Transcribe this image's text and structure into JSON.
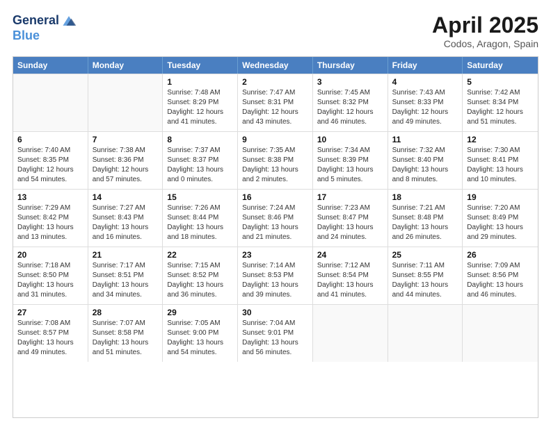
{
  "logo": {
    "line1": "General",
    "line2": "Blue"
  },
  "title": "April 2025",
  "subtitle": "Codos, Aragon, Spain",
  "days_of_week": [
    "Sunday",
    "Monday",
    "Tuesday",
    "Wednesday",
    "Thursday",
    "Friday",
    "Saturday"
  ],
  "weeks": [
    [
      {
        "day": "",
        "sunrise": "",
        "sunset": "",
        "daylight": ""
      },
      {
        "day": "",
        "sunrise": "",
        "sunset": "",
        "daylight": ""
      },
      {
        "day": "1",
        "sunrise": "Sunrise: 7:48 AM",
        "sunset": "Sunset: 8:29 PM",
        "daylight": "Daylight: 12 hours and 41 minutes."
      },
      {
        "day": "2",
        "sunrise": "Sunrise: 7:47 AM",
        "sunset": "Sunset: 8:31 PM",
        "daylight": "Daylight: 12 hours and 43 minutes."
      },
      {
        "day": "3",
        "sunrise": "Sunrise: 7:45 AM",
        "sunset": "Sunset: 8:32 PM",
        "daylight": "Daylight: 12 hours and 46 minutes."
      },
      {
        "day": "4",
        "sunrise": "Sunrise: 7:43 AM",
        "sunset": "Sunset: 8:33 PM",
        "daylight": "Daylight: 12 hours and 49 minutes."
      },
      {
        "day": "5",
        "sunrise": "Sunrise: 7:42 AM",
        "sunset": "Sunset: 8:34 PM",
        "daylight": "Daylight: 12 hours and 51 minutes."
      }
    ],
    [
      {
        "day": "6",
        "sunrise": "Sunrise: 7:40 AM",
        "sunset": "Sunset: 8:35 PM",
        "daylight": "Daylight: 12 hours and 54 minutes."
      },
      {
        "day": "7",
        "sunrise": "Sunrise: 7:38 AM",
        "sunset": "Sunset: 8:36 PM",
        "daylight": "Daylight: 12 hours and 57 minutes."
      },
      {
        "day": "8",
        "sunrise": "Sunrise: 7:37 AM",
        "sunset": "Sunset: 8:37 PM",
        "daylight": "Daylight: 13 hours and 0 minutes."
      },
      {
        "day": "9",
        "sunrise": "Sunrise: 7:35 AM",
        "sunset": "Sunset: 8:38 PM",
        "daylight": "Daylight: 13 hours and 2 minutes."
      },
      {
        "day": "10",
        "sunrise": "Sunrise: 7:34 AM",
        "sunset": "Sunset: 8:39 PM",
        "daylight": "Daylight: 13 hours and 5 minutes."
      },
      {
        "day": "11",
        "sunrise": "Sunrise: 7:32 AM",
        "sunset": "Sunset: 8:40 PM",
        "daylight": "Daylight: 13 hours and 8 minutes."
      },
      {
        "day": "12",
        "sunrise": "Sunrise: 7:30 AM",
        "sunset": "Sunset: 8:41 PM",
        "daylight": "Daylight: 13 hours and 10 minutes."
      }
    ],
    [
      {
        "day": "13",
        "sunrise": "Sunrise: 7:29 AM",
        "sunset": "Sunset: 8:42 PM",
        "daylight": "Daylight: 13 hours and 13 minutes."
      },
      {
        "day": "14",
        "sunrise": "Sunrise: 7:27 AM",
        "sunset": "Sunset: 8:43 PM",
        "daylight": "Daylight: 13 hours and 16 minutes."
      },
      {
        "day": "15",
        "sunrise": "Sunrise: 7:26 AM",
        "sunset": "Sunset: 8:44 PM",
        "daylight": "Daylight: 13 hours and 18 minutes."
      },
      {
        "day": "16",
        "sunrise": "Sunrise: 7:24 AM",
        "sunset": "Sunset: 8:46 PM",
        "daylight": "Daylight: 13 hours and 21 minutes."
      },
      {
        "day": "17",
        "sunrise": "Sunrise: 7:23 AM",
        "sunset": "Sunset: 8:47 PM",
        "daylight": "Daylight: 13 hours and 24 minutes."
      },
      {
        "day": "18",
        "sunrise": "Sunrise: 7:21 AM",
        "sunset": "Sunset: 8:48 PM",
        "daylight": "Daylight: 13 hours and 26 minutes."
      },
      {
        "day": "19",
        "sunrise": "Sunrise: 7:20 AM",
        "sunset": "Sunset: 8:49 PM",
        "daylight": "Daylight: 13 hours and 29 minutes."
      }
    ],
    [
      {
        "day": "20",
        "sunrise": "Sunrise: 7:18 AM",
        "sunset": "Sunset: 8:50 PM",
        "daylight": "Daylight: 13 hours and 31 minutes."
      },
      {
        "day": "21",
        "sunrise": "Sunrise: 7:17 AM",
        "sunset": "Sunset: 8:51 PM",
        "daylight": "Daylight: 13 hours and 34 minutes."
      },
      {
        "day": "22",
        "sunrise": "Sunrise: 7:15 AM",
        "sunset": "Sunset: 8:52 PM",
        "daylight": "Daylight: 13 hours and 36 minutes."
      },
      {
        "day": "23",
        "sunrise": "Sunrise: 7:14 AM",
        "sunset": "Sunset: 8:53 PM",
        "daylight": "Daylight: 13 hours and 39 minutes."
      },
      {
        "day": "24",
        "sunrise": "Sunrise: 7:12 AM",
        "sunset": "Sunset: 8:54 PM",
        "daylight": "Daylight: 13 hours and 41 minutes."
      },
      {
        "day": "25",
        "sunrise": "Sunrise: 7:11 AM",
        "sunset": "Sunset: 8:55 PM",
        "daylight": "Daylight: 13 hours and 44 minutes."
      },
      {
        "day": "26",
        "sunrise": "Sunrise: 7:09 AM",
        "sunset": "Sunset: 8:56 PM",
        "daylight": "Daylight: 13 hours and 46 minutes."
      }
    ],
    [
      {
        "day": "27",
        "sunrise": "Sunrise: 7:08 AM",
        "sunset": "Sunset: 8:57 PM",
        "daylight": "Daylight: 13 hours and 49 minutes."
      },
      {
        "day": "28",
        "sunrise": "Sunrise: 7:07 AM",
        "sunset": "Sunset: 8:58 PM",
        "daylight": "Daylight: 13 hours and 51 minutes."
      },
      {
        "day": "29",
        "sunrise": "Sunrise: 7:05 AM",
        "sunset": "Sunset: 9:00 PM",
        "daylight": "Daylight: 13 hours and 54 minutes."
      },
      {
        "day": "30",
        "sunrise": "Sunrise: 7:04 AM",
        "sunset": "Sunset: 9:01 PM",
        "daylight": "Daylight: 13 hours and 56 minutes."
      },
      {
        "day": "",
        "sunrise": "",
        "sunset": "",
        "daylight": ""
      },
      {
        "day": "",
        "sunrise": "",
        "sunset": "",
        "daylight": ""
      },
      {
        "day": "",
        "sunrise": "",
        "sunset": "",
        "daylight": ""
      }
    ]
  ]
}
